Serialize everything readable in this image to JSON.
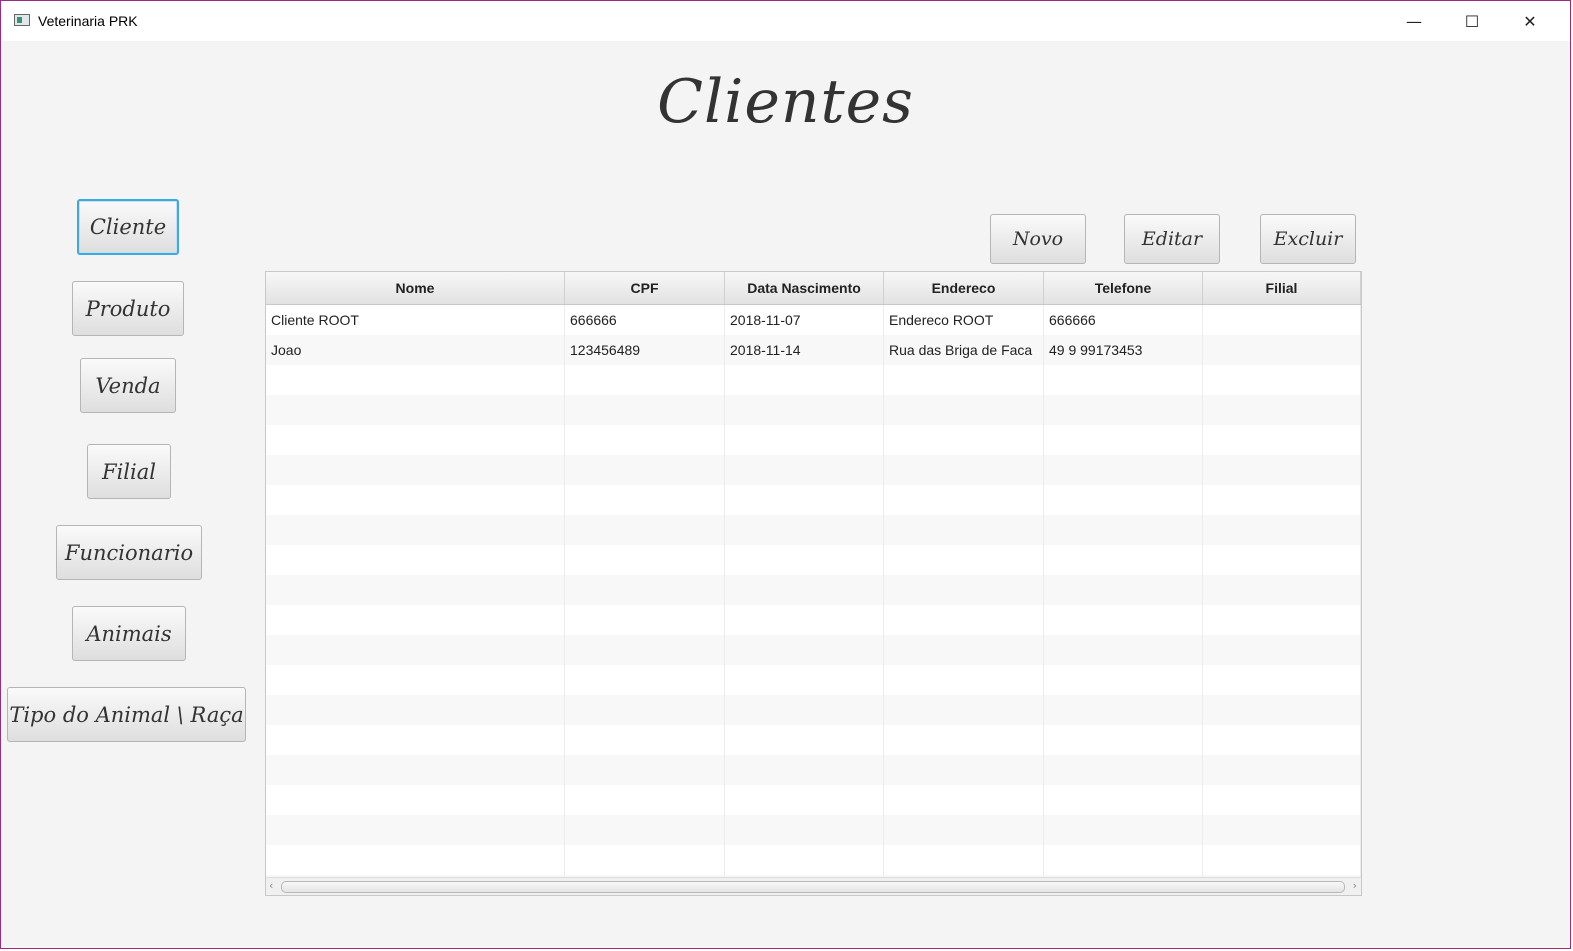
{
  "window": {
    "title": "Veterinaria PRK",
    "controls": {
      "minimize": "—",
      "maximize": "☐",
      "close": "✕"
    }
  },
  "page": {
    "heading": "Clientes"
  },
  "sidebar": {
    "items": [
      {
        "label": "Cliente",
        "active": true
      },
      {
        "label": "Produto"
      },
      {
        "label": "Venda"
      },
      {
        "label": "Filial"
      },
      {
        "label": "Funcionario"
      },
      {
        "label": "Animais"
      },
      {
        "label": "Tipo do Animal \\ Raça"
      }
    ]
  },
  "actions": {
    "new": "Novo",
    "edit": "Editar",
    "delete": "Excluir"
  },
  "table": {
    "columns": [
      "Nome",
      "CPF",
      "Data Nascimento",
      "Endereco",
      "Telefone",
      "Filial"
    ],
    "rows": [
      [
        "Cliente ROOT",
        "666666",
        "2018-11-07",
        "Endereco ROOT",
        "666666",
        ""
      ],
      [
        "Joao",
        "123456489",
        "2018-11-14",
        "Rua das Briga de Faca",
        "49 9 99173453",
        ""
      ]
    ]
  },
  "icons": {
    "app": "app-window-icon",
    "scroll_left": "chevron-left-icon",
    "scroll_right": "chevron-right-icon"
  },
  "colors": {
    "accent_focus": "#3fa8dd",
    "window_border": "#9b2d7f"
  }
}
